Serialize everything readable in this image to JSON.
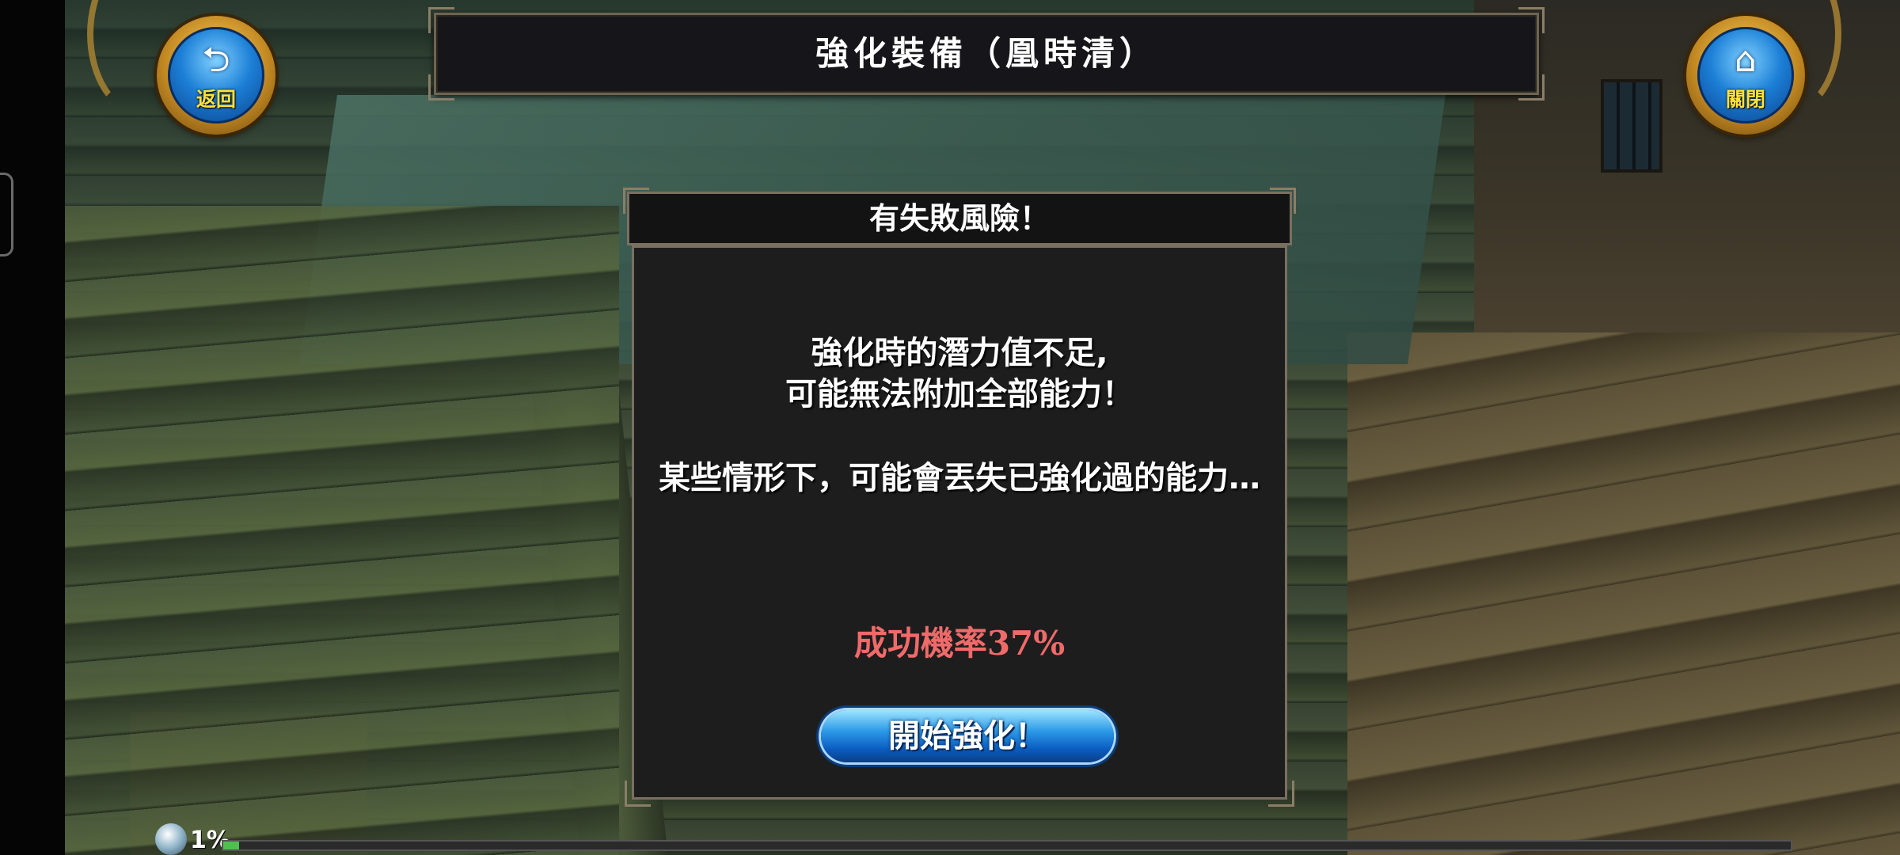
{
  "nav": {
    "back_label": "返回",
    "close_label": "關閉",
    "back_icon": "back-arrow-icon",
    "close_icon": "home-icon"
  },
  "header": {
    "title": "強化裝備（凰時清）"
  },
  "dialog": {
    "title": "有失敗風險！",
    "line1": "強化時的潛力值不足,",
    "line2": "可能無法附加全部能力！",
    "line3": "某些情形下，可能會丟失已強化過的能力…",
    "success_rate": "成功機率37%",
    "start_button_label": "開始強化！"
  },
  "status": {
    "xp_percent_text": "1%",
    "xp_fraction": 0.01
  },
  "colors": {
    "success_rate": "#f06a6a",
    "button_blue": "#2d9ae8",
    "label_yellow": "#ffe23a",
    "xp_green": "#4fbf4f"
  }
}
